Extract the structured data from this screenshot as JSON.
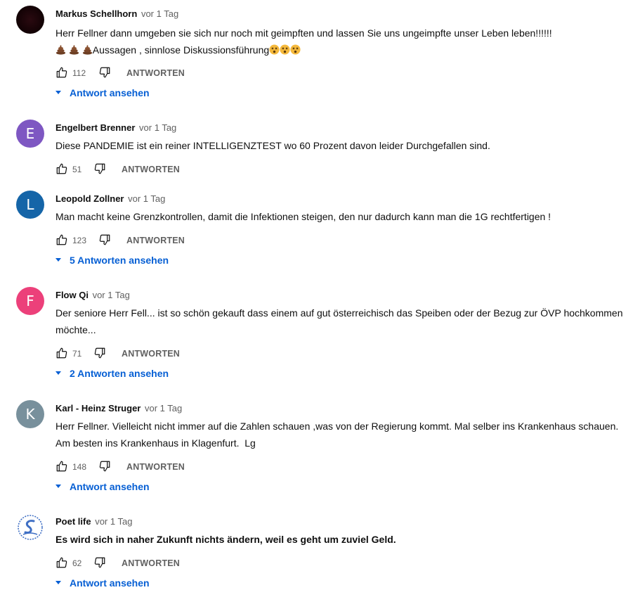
{
  "comments": [
    {
      "author": "Markus Schellhorn",
      "time": "vor 1 Tag",
      "line1": "Herr Fellner dann umgeben sie sich nur noch mit geimpften und lassen Sie uns ungeimpfte unser Leben leben!!!!!!",
      "line2": "Aussagen , sinnlose Diskussionsführung",
      "avatar": {
        "letter": "",
        "color": "#1a0509"
      },
      "likes": "112",
      "reply_label": "ANTWORTEN",
      "replies_label": "Antwort ansehen"
    },
    {
      "author": "Engelbert Brenner",
      "time": "vor 1 Tag",
      "line1": "Diese PANDEMIE ist ein reiner INTELLIGENZTEST wo 60 Prozent davon leider Durchgefallen sind.",
      "avatar": {
        "letter": "E",
        "color": "#7e57c2"
      },
      "likes": "51",
      "reply_label": "ANTWORTEN"
    },
    {
      "author": "Leopold Zollner",
      "time": "vor 1 Tag",
      "line1": "Man macht keine Grenzkontrollen, damit die Infektionen steigen, den nur dadurch kann man die 1G rechtfertigen !",
      "avatar": {
        "letter": "L",
        "color": "#1565a8"
      },
      "likes": "123",
      "reply_label": "ANTWORTEN",
      "replies_label": "5 Antworten ansehen"
    },
    {
      "author": "Flow Qi",
      "time": "vor 1 Tag",
      "line1": "Der seniore Herr Fell... ist so schön gekauft dass einem auf gut österreichisch das Speiben oder der Bezug zur ÖVP hochkommen",
      "line2": "möchte...",
      "avatar": {
        "letter": "F",
        "color": "#ec407a"
      },
      "likes": "71",
      "reply_label": "ANTWORTEN",
      "replies_label": "2 Antworten ansehen"
    },
    {
      "author": "Karl - Heinz Struger",
      "time": "vor 1 Tag",
      "line1": "Herr Fellner. Vielleicht nicht immer auf die Zahlen schauen ,was von der Regierung kommt. Mal selber ins Krankenhaus schauen.",
      "line2": "Am besten ins Krankenhaus in Klagenfurt.  Lg",
      "avatar": {
        "letter": "K",
        "color": "#78909c"
      },
      "likes": "148",
      "reply_label": "ANTWORTEN",
      "replies_label": "Antwort ansehen"
    },
    {
      "author": "Poet life",
      "time": "vor 1 Tag",
      "line1": "Es wird sich in naher Zukunft nichts ändern, weil es geht um zuviel Geld.",
      "avatar": {
        "letter": "",
        "color": "#ffffff"
      },
      "likes": "62",
      "reply_label": "ANTWORTEN",
      "replies_label": "Antwort ansehen"
    }
  ],
  "colors": {
    "link": "#065fd4",
    "meta": "#606060",
    "text": "#0f0f0f"
  }
}
